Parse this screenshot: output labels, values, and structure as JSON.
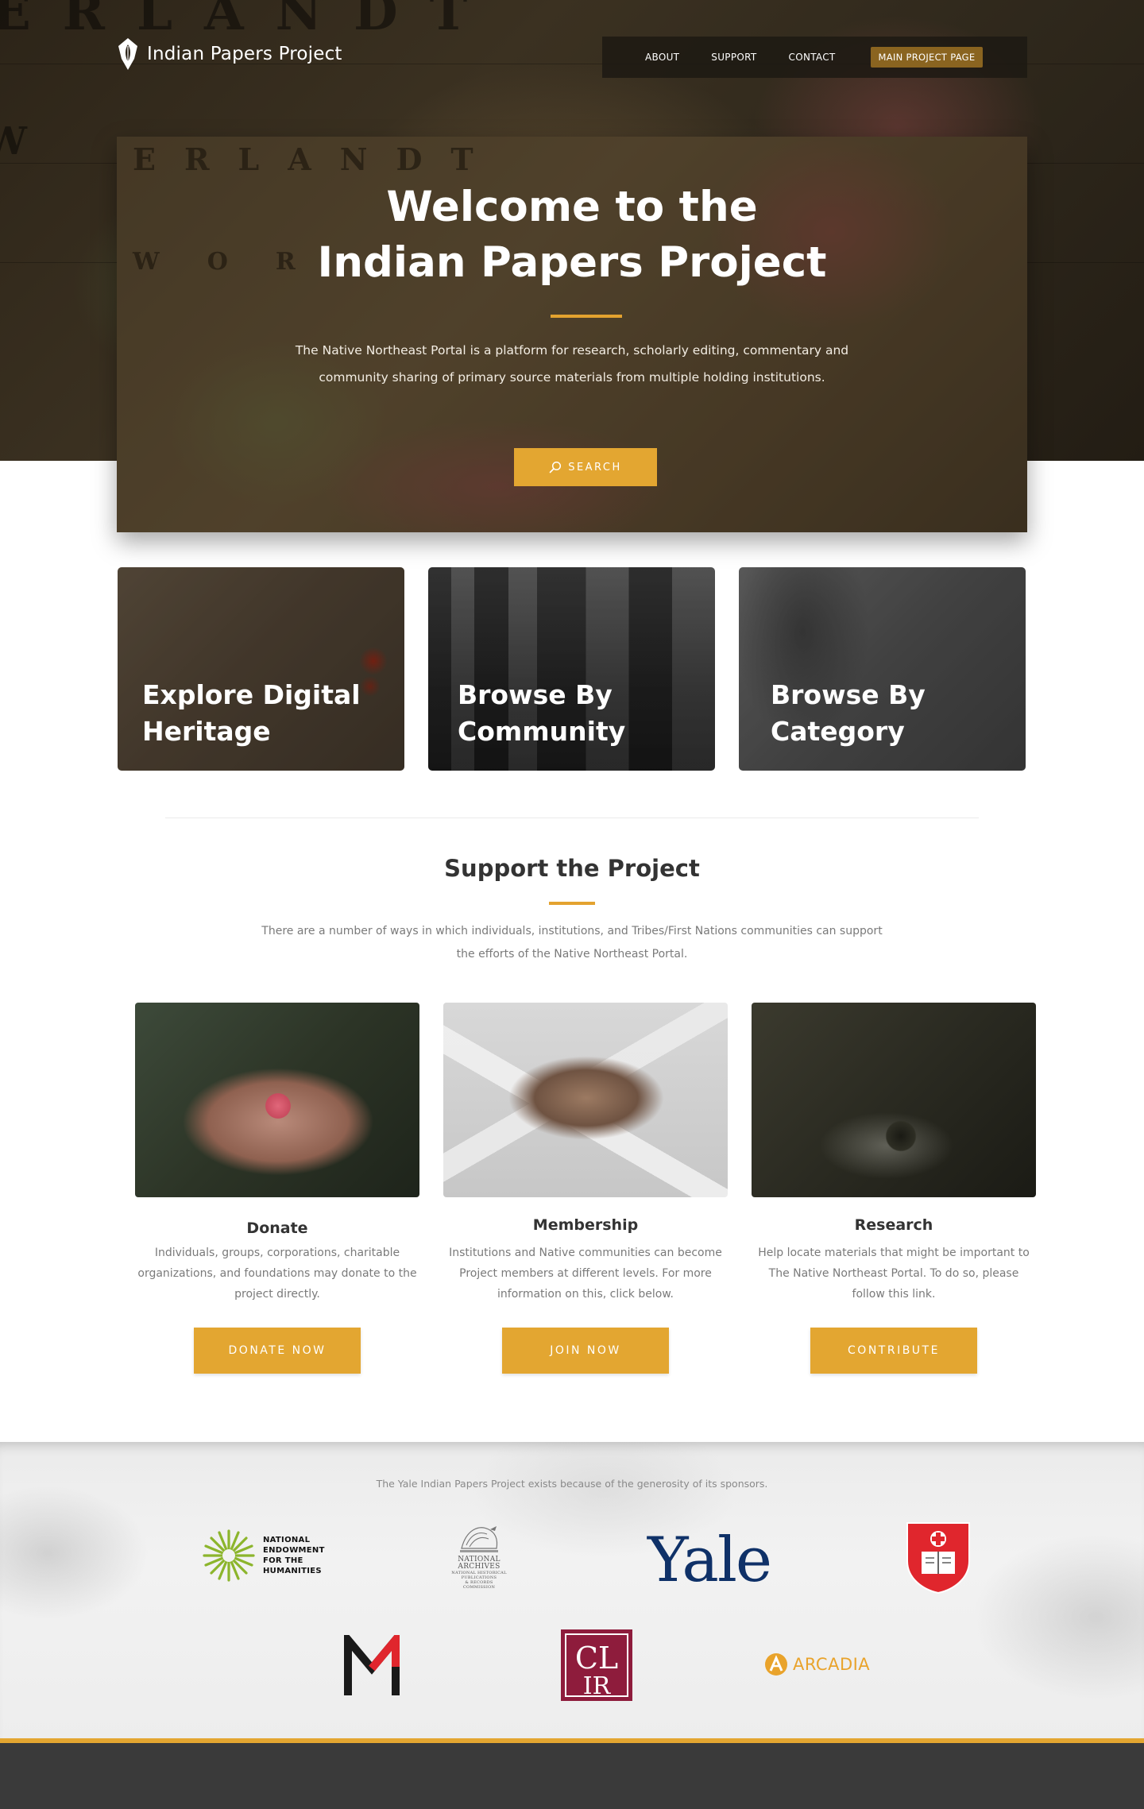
{
  "brand": {
    "name": "Indian Papers Project",
    "logo_icon": "quill-pen-nib-icon"
  },
  "nav": {
    "items": [
      {
        "label": "ABOUT"
      },
      {
        "label": "SUPPORT"
      },
      {
        "label": "CONTACT"
      }
    ],
    "cta_label": "MAIN PROJECT PAGE"
  },
  "hero": {
    "title_line1": "Welcome to the",
    "title_line2": "Indian Papers Project",
    "description": "The Native Northeast Portal is a platform for research, scholarly editing, commentary and community sharing of primary source materials from multiple holding institutions.",
    "search_label": "SEARCH",
    "search_icon": "search-icon"
  },
  "tiles": [
    {
      "line1": "Explore Digital",
      "line2": "Heritage"
    },
    {
      "line1": "Browse By",
      "line2": "Community"
    },
    {
      "line1": "Browse By",
      "line2": "Category"
    }
  ],
  "support": {
    "title": "Support the Project",
    "description": "There are a number of ways in which individuals, institutions, and Tribes/First Nations communities can support the efforts of the Native Northeast Portal.",
    "cards": [
      {
        "title": "Donate",
        "text": "Individuals, groups, corporations, charitable organizations, and foundations may donate to the project directly.",
        "button": "DONATE NOW"
      },
      {
        "title": "Membership",
        "text": "Institutions and Native communities can become Project members at different levels. For more information on this, click below.",
        "button": "JOIN NOW"
      },
      {
        "title": "Research",
        "text": "Help locate materials that might be important to The Native Northeast Portal. To do so, please follow this link.",
        "button": "CONTRIBUTE"
      }
    ]
  },
  "sponsors": {
    "note": "The Yale Indian Papers Project exists because of the generosity of its sponsors.",
    "neh_lines": [
      "NATIONAL",
      "ENDOWMENT",
      "FOR THE",
      "HUMANITIES"
    ],
    "nara_lines": [
      "NATIONAL",
      "ARCHIVES",
      "NATIONAL HISTORICAL",
      "PUBLICATIONS",
      "& RECORDS COMMISSION"
    ],
    "yale": "Yale",
    "clir": "CLIR",
    "arcadia": "ARCADIA"
  },
  "colors": {
    "accent": "#e3a631",
    "nav_cta": "#8a6420",
    "yale_blue": "#0f3168",
    "shield_red": "#e0262d",
    "clir_maroon": "#8e1c3c",
    "footer": "#3a3a3a"
  }
}
